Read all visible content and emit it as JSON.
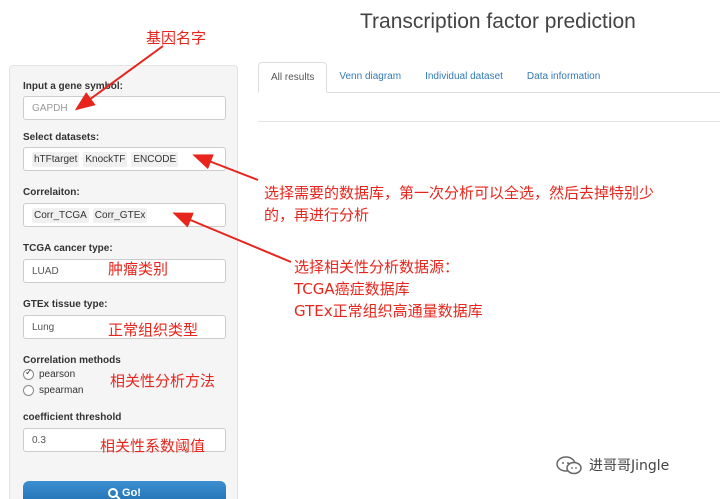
{
  "page": {
    "title": "Transcription factor prediction"
  },
  "tabs": [
    "All results",
    "Venn diagram",
    "Individual dataset",
    "Data information"
  ],
  "sidebar": {
    "gene": {
      "label": "Input a gene symbol:",
      "placeholder": "GAPDH"
    },
    "datasets": {
      "label": "Select datasets:",
      "chips": [
        "hTFtarget",
        "KnockTF",
        "ENCODE"
      ]
    },
    "correlation": {
      "label": "Correlaiton:",
      "chips": [
        "Corr_TCGA",
        "Corr_GTEx"
      ]
    },
    "tcga": {
      "label": "TCGA cancer type:",
      "value": "LUAD"
    },
    "gtex": {
      "label": "GTEx tissue type:",
      "value": "Lung"
    },
    "methods": {
      "label": "Correlation methods",
      "options": [
        "pearson",
        "spearman"
      ],
      "selected": "pearson"
    },
    "threshold": {
      "label": "coefficient threshold",
      "value": "0.3"
    },
    "go_label": "Go!"
  },
  "annotations": {
    "gene_name": "基因名字",
    "select_db_line1": "选择需要的数据库，第一次分析可以全选，然后去掉特别少",
    "select_db_line2": "的，再进行分析",
    "corr_line1": "选择相关性分析数据源：",
    "corr_line2": "TCGA癌症数据库",
    "corr_line3": "GTEx正常组织高通量数据库",
    "tumor_type": "肿瘤类别",
    "normal_tissue": "正常组织类型",
    "corr_method": "相关性分析方法",
    "corr_threshold": "相关性系数阈值"
  },
  "watermark": {
    "text": "进哥哥Jingle"
  },
  "colors": {
    "annotation": "#e8251c",
    "button": "#2a7bbf",
    "link": "#337ab7"
  }
}
